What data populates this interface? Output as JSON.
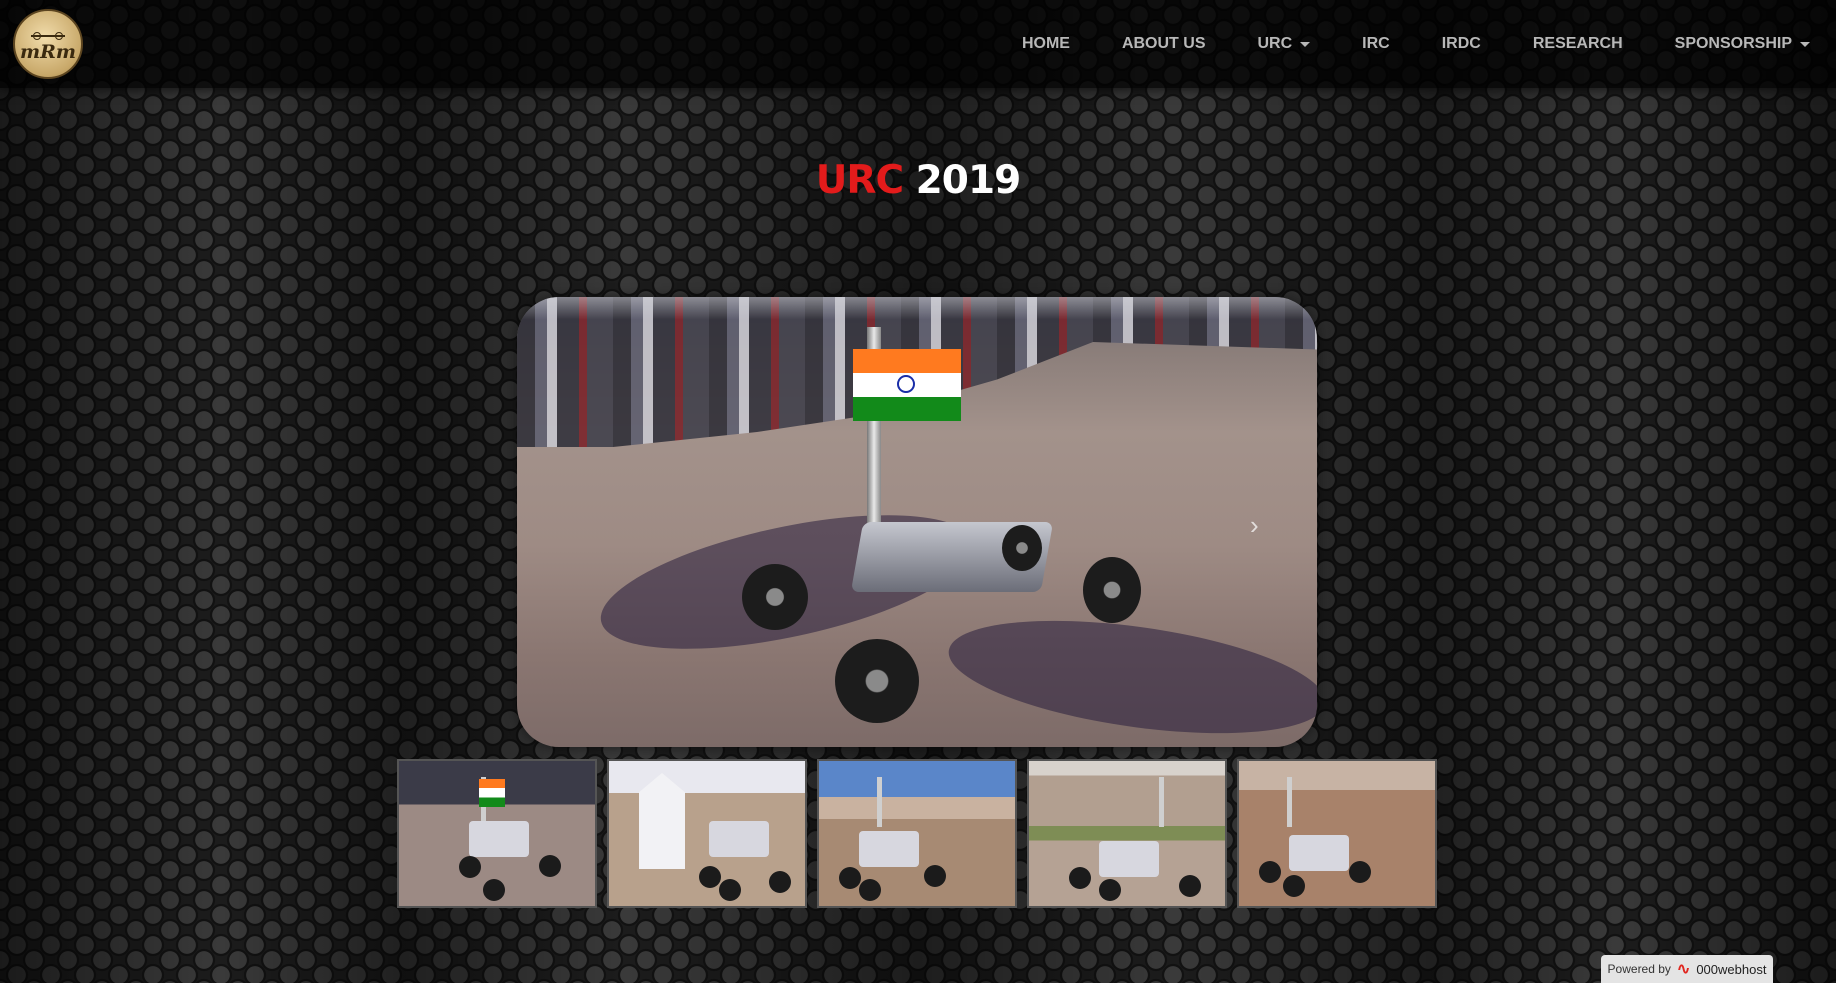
{
  "navbar": {
    "logo_text": "mRm",
    "items": [
      {
        "label": "HOME",
        "dropdown": false
      },
      {
        "label": "ABOUT US",
        "dropdown": false
      },
      {
        "label": "URC",
        "dropdown": true
      },
      {
        "label": "IRC",
        "dropdown": false
      },
      {
        "label": "IRDC",
        "dropdown": false
      },
      {
        "label": "RESEARCH",
        "dropdown": false
      },
      {
        "label": "SPONSORSHIP",
        "dropdown": true
      }
    ]
  },
  "title": {
    "highlight": "URC",
    "rest": "2019",
    "highlight_color": "#e31b1b"
  },
  "carousel": {
    "next_icon": "chevron-right-icon",
    "active_index": 0,
    "thumbnails": [
      "rover-with-flag-crowd",
      "rover-with-white-tower",
      "rover-in-desert-hills",
      "rover-near-bushes",
      "rover-on-rocky-terrain"
    ]
  },
  "footer_badge": {
    "powered_by": "Powered by",
    "brand": "000webhost"
  }
}
